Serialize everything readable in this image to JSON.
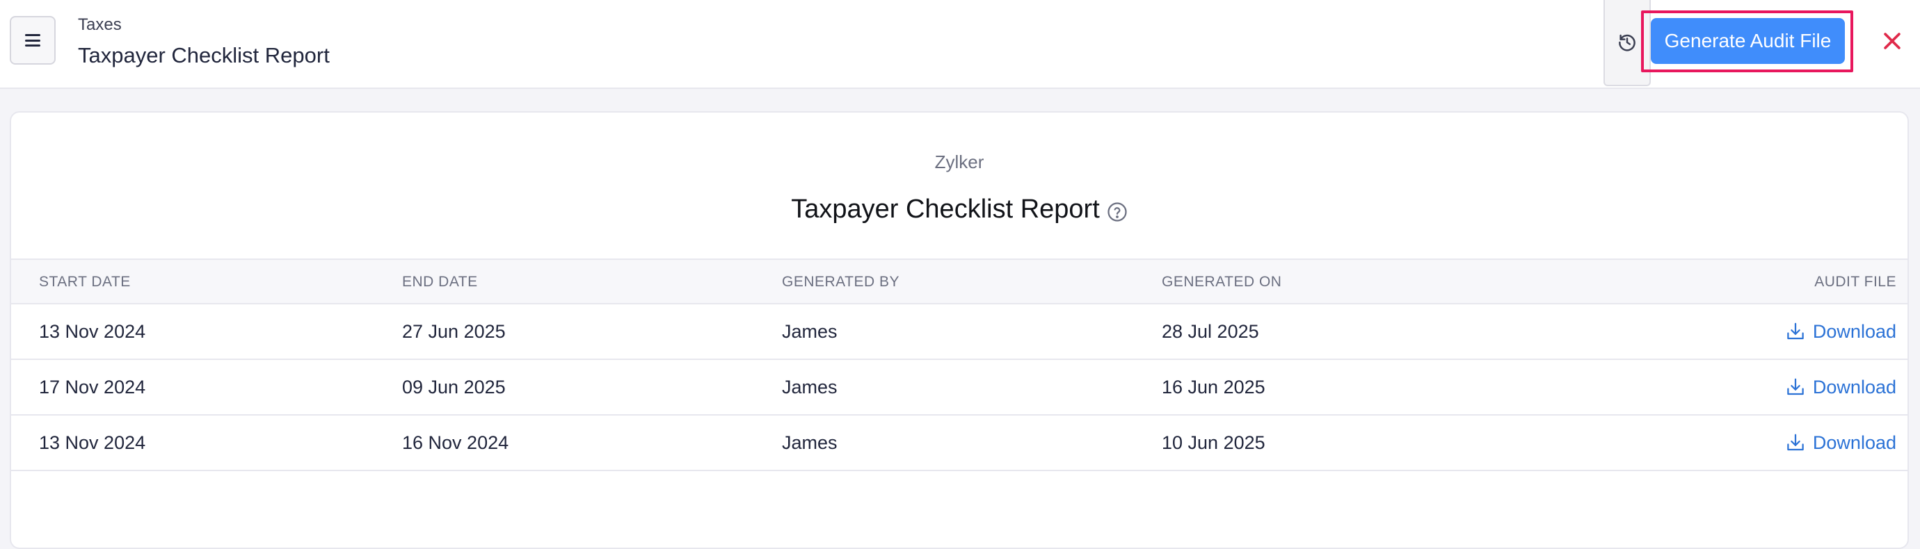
{
  "header": {
    "breadcrumb": "Taxes",
    "title": "Taxpayer Checklist Report",
    "generate_button": "Generate Audit File",
    "menu_icon": "hamburger-icon",
    "history_icon": "history-icon",
    "close_icon": "close-icon"
  },
  "report": {
    "organization": "Zylker",
    "title": "Taxpayer Checklist Report",
    "help_icon": "help-icon"
  },
  "table": {
    "columns": [
      "START DATE",
      "END DATE",
      "GENERATED BY",
      "GENERATED ON",
      "AUDIT FILE"
    ],
    "rows": [
      {
        "start": "13 Nov 2024",
        "end": "27 Jun 2025",
        "by": "James",
        "on": "28 Jul 2025",
        "file": "Download"
      },
      {
        "start": "17 Nov 2024",
        "end": "09 Jun 2025",
        "by": "James",
        "on": "16 Jun 2025",
        "file": "Download"
      },
      {
        "start": "13 Nov 2024",
        "end": "16 Nov 2024",
        "by": "James",
        "on": "10 Jun 2025",
        "file": "Download"
      }
    ]
  },
  "colors": {
    "primary": "#408dfb",
    "link": "#2b72d6",
    "highlight": "#e8175d",
    "close": "#e0294a"
  }
}
